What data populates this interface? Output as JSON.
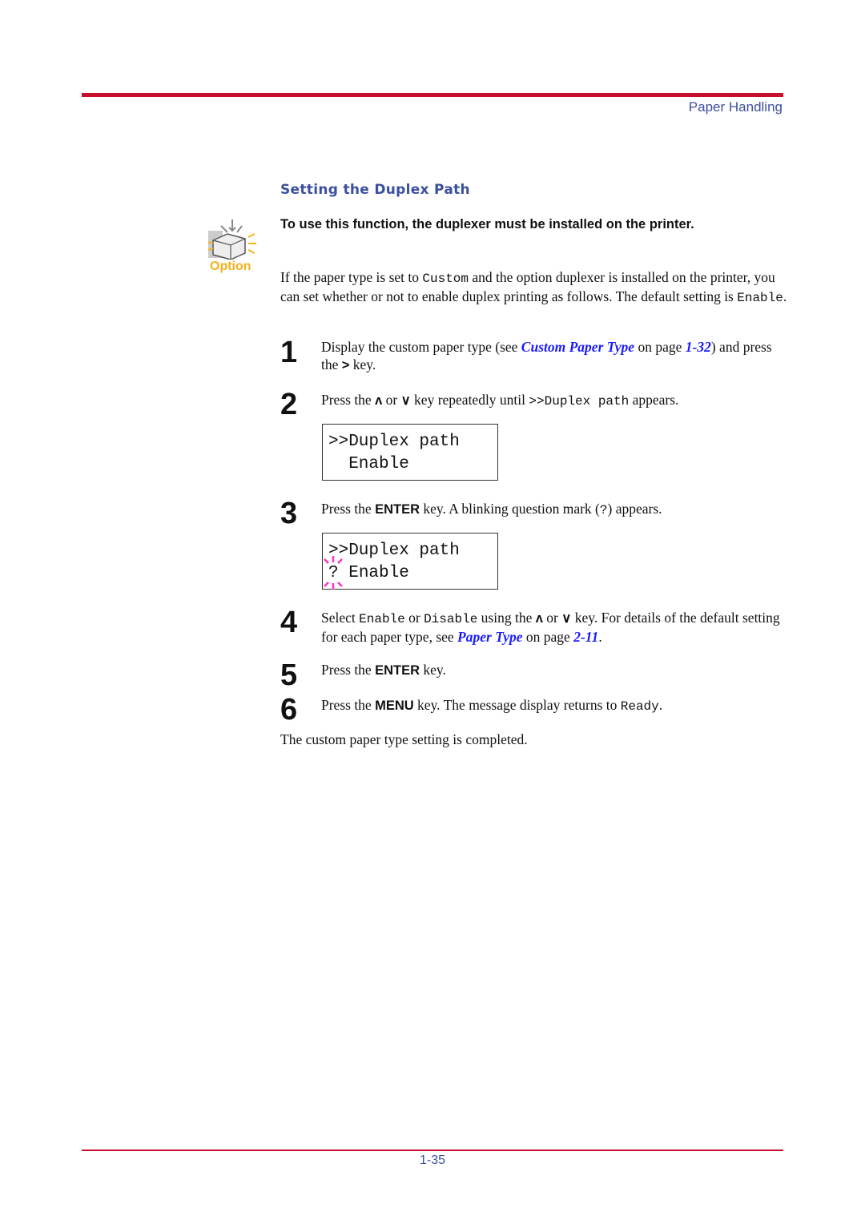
{
  "header": {
    "section": "Paper Handling"
  },
  "title": "Setting the Duplex Path",
  "option_icon": {
    "label": "Option",
    "icon": "printer-option-icon",
    "color": "#f5b21b"
  },
  "note": "To use this function, the duplexer must be installed on the printer.",
  "intro": {
    "t0": "If the paper type is set to ",
    "m0": "Custom",
    "t1": " and the option duplexer is installed on the printer, you can set whether or not to enable duplex printing as follows. The default setting is ",
    "m1": "Enable",
    "t2": "."
  },
  "steps": [
    {
      "n": "1",
      "t0": "Display the custom paper type (see ",
      "l0": "Custom Paper Type",
      "t1": " on page ",
      "l1": "1-32",
      "t2": ") and press the ",
      "b0": ">",
      "t3": " key."
    },
    {
      "n": "2",
      "t0": "Press the ",
      "u": "ʌ",
      "t1": " or ",
      "d": "∨",
      "t2": " key repeatedly until ",
      "m0": ">>Duplex path",
      "t3": " appears."
    },
    {
      "n": "3",
      "t0": "Press the ",
      "b0": "ENTER",
      "t1": " key. A blinking question mark (",
      "m0": "?",
      "t2": ") appears."
    },
    {
      "n": "4",
      "t0": "Select ",
      "m0": "Enable",
      "t1": " or ",
      "m1": "Disable",
      "t2": " using the ",
      "u": "ʌ",
      "t3": " or ",
      "d": "∨",
      "t4": " key. For details of the default setting for each paper type, see ",
      "l0": "Paper Type",
      "t5": " on page ",
      "l1": "2-11",
      "t6": "."
    },
    {
      "n": "5",
      "t0": "Press the ",
      "b0": "ENTER",
      "t1": " key."
    },
    {
      "n": "6",
      "t0": "Press the ",
      "b0": "MENU",
      "t1": " key. The message display returns to ",
      "m0": "Ready",
      "t2": "."
    }
  ],
  "lcd1": {
    "line1": ">>Duplex path",
    "line2": "  Enable"
  },
  "lcd2": {
    "line1": ">>Duplex path",
    "q": "?",
    "line2": " Enable",
    "blink_color": "#ff33cc"
  },
  "conclusion": "The custom paper type setting is completed.",
  "footer": {
    "page": "1-35"
  },
  "colors": {
    "rule": "#c8102e",
    "heading": "#3b4fa0",
    "link": "#1a1aff"
  }
}
